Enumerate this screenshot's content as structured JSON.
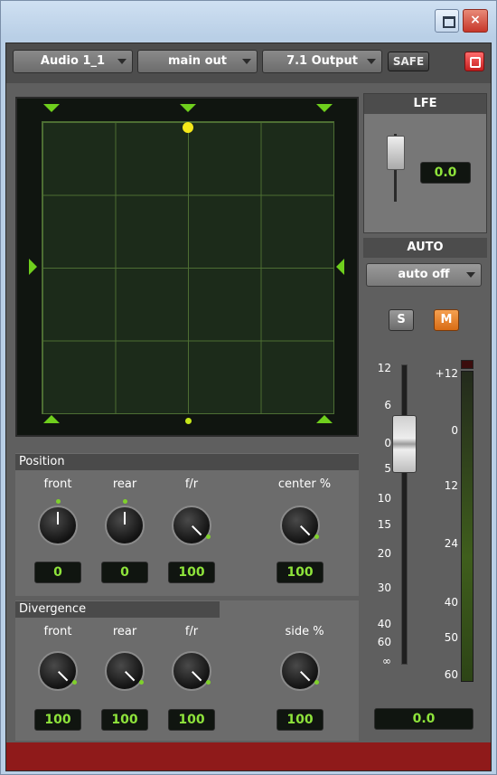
{
  "window": {
    "restore_icon": "restore-icon",
    "close_label": "×"
  },
  "header": {
    "track": "Audio 1_1",
    "output": "main out",
    "output_format": "7.1 Output",
    "safe_label": "SAFE",
    "record_icon": "target-icon"
  },
  "lfe": {
    "title": "LFE",
    "value": "0.0"
  },
  "auto": {
    "title": "AUTO",
    "mode": "auto off",
    "solo": "S",
    "mute": "M"
  },
  "fader": {
    "left_scale": [
      "12",
      "6",
      "0",
      "5",
      "10",
      "15",
      "20",
      "30",
      "40",
      "60",
      "∞"
    ],
    "right_scale": [
      "+12",
      "0",
      "12",
      "24",
      "40",
      "50",
      "60"
    ],
    "value": "0.0"
  },
  "position": {
    "title": "Position",
    "knobs": [
      {
        "label": "front",
        "value": "0"
      },
      {
        "label": "rear",
        "value": "0"
      },
      {
        "label": "f/r",
        "value": "100"
      },
      {
        "label": "center %",
        "value": "100"
      }
    ]
  },
  "divergence": {
    "title": "Divergence",
    "knobs": [
      {
        "label": "front",
        "value": "100"
      },
      {
        "label": "rear",
        "value": "100"
      },
      {
        "label": "f/r",
        "value": "100"
      },
      {
        "label": "side %",
        "value": "100"
      }
    ]
  },
  "colors": {
    "accent_green": "#8ee33b",
    "mute_orange": "#e07820",
    "bottom_red": "#8f1a1a"
  }
}
